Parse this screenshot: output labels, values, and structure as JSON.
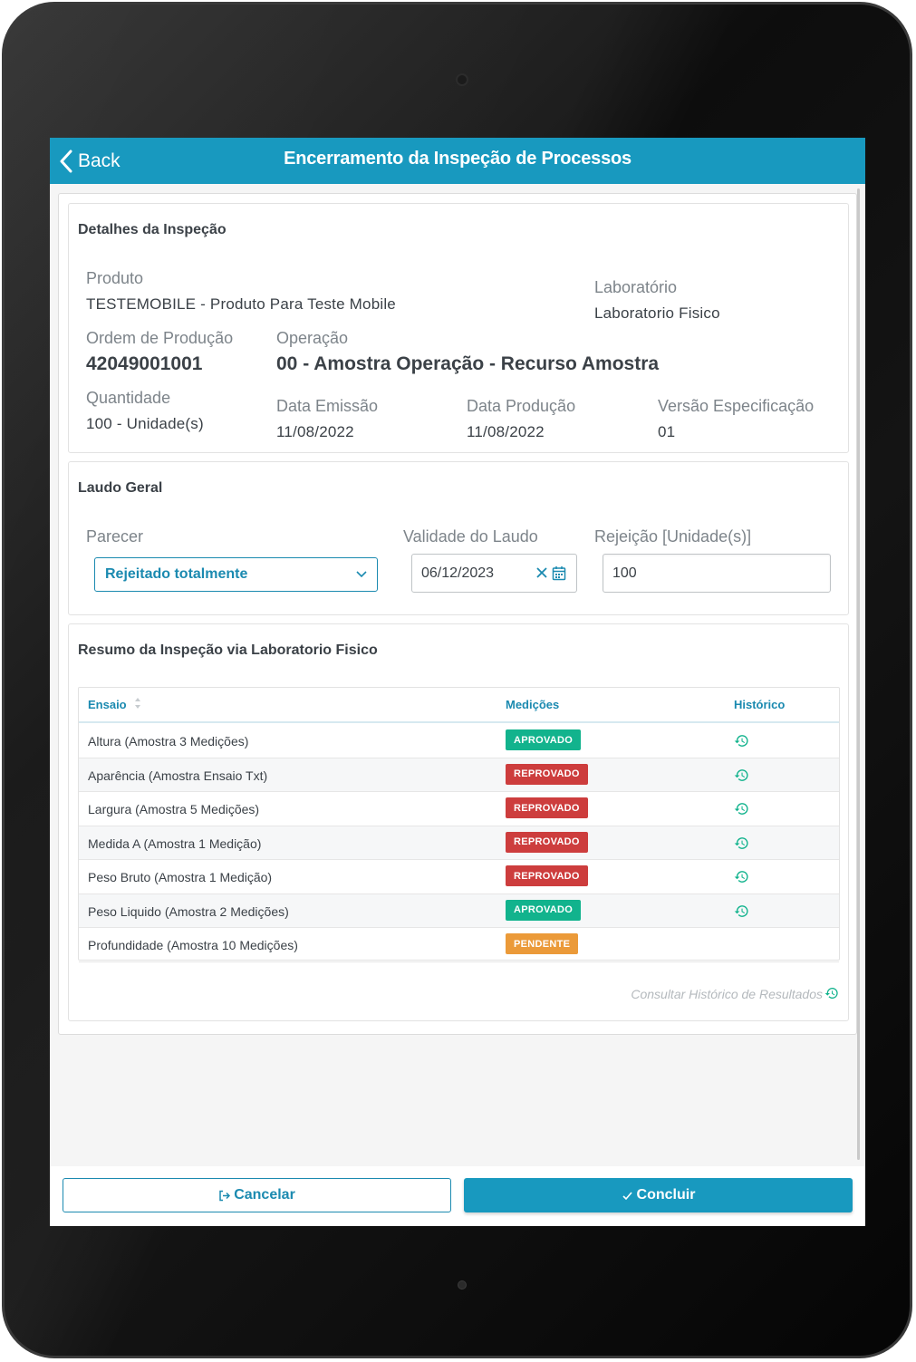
{
  "header": {
    "back_label": "Back",
    "title": "Encerramento da Inspeção de Processos"
  },
  "details": {
    "section_title": "Detalhes da Inspeção",
    "produto_label": "Produto",
    "produto_value": "TESTEMOBILE - Produto Para Teste Mobile",
    "laboratorio_label": "Laboratório",
    "laboratorio_value": "Laboratorio Fisico",
    "ordem_label": "Ordem de Produção",
    "ordem_value": "42049001001",
    "operacao_label": "Operação",
    "operacao_value": "00 - Amostra Operação - Recurso Amostra",
    "quantidade_label": "Quantidade",
    "quantidade_value": "100 - Unidade(s)",
    "data_emissao_label": "Data Emissão",
    "data_emissao_value": "11/08/2022",
    "data_producao_label": "Data Produção",
    "data_producao_value": "11/08/2022",
    "versao_label": "Versão Especificação",
    "versao_value": "01"
  },
  "laudo": {
    "section_title": "Laudo Geral",
    "parecer_label": "Parecer",
    "parecer_value": "Rejeitado totalmente",
    "validade_label": "Validade do Laudo",
    "validade_value": "06/12/2023",
    "rejeicao_label": "Rejeição [Unidade(s)]",
    "rejeicao_value": "100"
  },
  "resumo": {
    "section_title": "Resumo da Inspeção via Laboratorio Fisico",
    "columns": [
      "Ensaio",
      "Medições",
      "Histórico"
    ],
    "rows": [
      {
        "ensaio": "Altura (Amostra 3 Medições)",
        "status": "APROVADO",
        "history": true
      },
      {
        "ensaio": "Aparência (Amostra Ensaio Txt)",
        "status": "REPROVADO",
        "history": true
      },
      {
        "ensaio": "Largura (Amostra 5 Medições)",
        "status": "REPROVADO",
        "history": true
      },
      {
        "ensaio": "Medida A (Amostra 1 Medição)",
        "status": "REPROVADO",
        "history": true
      },
      {
        "ensaio": "Peso Bruto (Amostra 1 Medição)",
        "status": "REPROVADO",
        "history": true
      },
      {
        "ensaio": "Peso Liquido (Amostra 2 Medições)",
        "status": "APROVADO",
        "history": true
      },
      {
        "ensaio": "Profundidade (Amostra 10 Medições)",
        "status": "PENDENTE",
        "history": false
      }
    ],
    "consult_link": "Consultar Histórico de Resultados"
  },
  "footer": {
    "cancel_label": "Cancelar",
    "confirm_label": "Concluir"
  },
  "colors": {
    "brand": "#1899bf",
    "approved": "#12b38d",
    "rejected": "#cd3d3d",
    "pending": "#eb9a39"
  },
  "icons": {
    "back": "chevron-left-icon",
    "dropdown": "chevron-down-icon",
    "clear": "close-icon",
    "calendar": "calendar-icon",
    "history": "history-icon",
    "sort": "sort-icon",
    "cancel": "sign-out-icon",
    "confirm": "check-icon"
  }
}
